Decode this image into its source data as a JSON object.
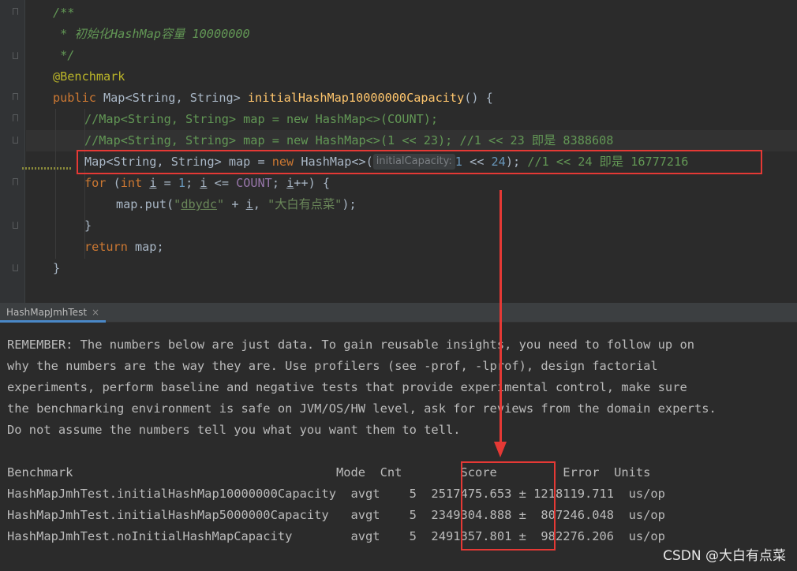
{
  "editor": {
    "lines": {
      "l1": "/**",
      "l2": " * 初始化HashMap容量 10000000",
      "l3": " */",
      "l4": "@Benchmark",
      "l5_kw": "public",
      "l5_type": " Map<String, String> ",
      "l5_fn": "initialHashMap10000000Capacity",
      "l5_rest": "() {",
      "l6": "//Map<String, String> map = new HashMap<>(COUNT);",
      "l7": "//Map<String, String> map = new HashMap<>(1 << 23); //1 << 23 即是 8388608",
      "l8_a": "Map<String, String> map = ",
      "l8_new": "new",
      "l8_b": " HashMap<>(",
      "l8_hint": "initialCapacity:",
      "l8_n1": "1",
      "l8_op": " << ",
      "l8_n2": "24",
      "l8_c": "); ",
      "l8_cm": "//1 << 24 即是 16777216",
      "l9_for": "for",
      "l9_p1": " (",
      "l9_int": "int",
      "l9_sp": " ",
      "l9_i1": "i",
      "l9_eq": " = ",
      "l9_one": "1",
      "l9_semi": "; ",
      "l9_i2": "i",
      "l9_le": " <= ",
      "l9_count": "COUNT",
      "l9_semi2": "; ",
      "l9_i3": "i",
      "l9_end": "++) {",
      "l10_a": "map.put(",
      "l10_q1": "\"",
      "l10_s1": "dbydc",
      "l10_q2": "\"",
      "l10_plus": " + ",
      "l10_i": "i",
      "l10_comma": ", ",
      "l10_s2": "\"大白有点菜\"",
      "l10_end": ");",
      "l11": "}",
      "l12_ret": "return",
      "l12_rest": " map;",
      "l13": "}"
    }
  },
  "run_panel": {
    "tab_label": "HashMapJmhTest",
    "tab_close": "×"
  },
  "console": {
    "remember": [
      "REMEMBER: The numbers below are just data. To gain reusable insights, you need to follow up on",
      "why the numbers are the way they are. Use profilers (see -prof, -lprof), design factorial",
      "experiments, perform baseline and negative tests that provide experimental control, make sure",
      "the benchmarking environment is safe on JVM/OS/HW level, ask for reviews from the domain experts.",
      "Do not assume the numbers tell you what you want them to tell."
    ],
    "table": {
      "header": "Benchmark                                    Mode  Cnt        Score         Error  Units",
      "rows": [
        "HashMapJmhTest.initialHashMap10000000Capacity  avgt    5  2517475.653 ± 1218119.711  us/op",
        "HashMapJmhTest.initialHashMap5000000Capacity   avgt    5  2349304.888 ±  807246.048  us/op",
        "HashMapJmhTest.noInitialHashMapCapacity        avgt    5  2491357.801 ±  982276.206  us/op"
      ]
    }
  },
  "watermark": "CSDN @大白有点菜",
  "colors": {
    "annotation_red": "#e53935",
    "editor_bg": "#2b2b2b",
    "tab_accent": "#4a88c7"
  }
}
